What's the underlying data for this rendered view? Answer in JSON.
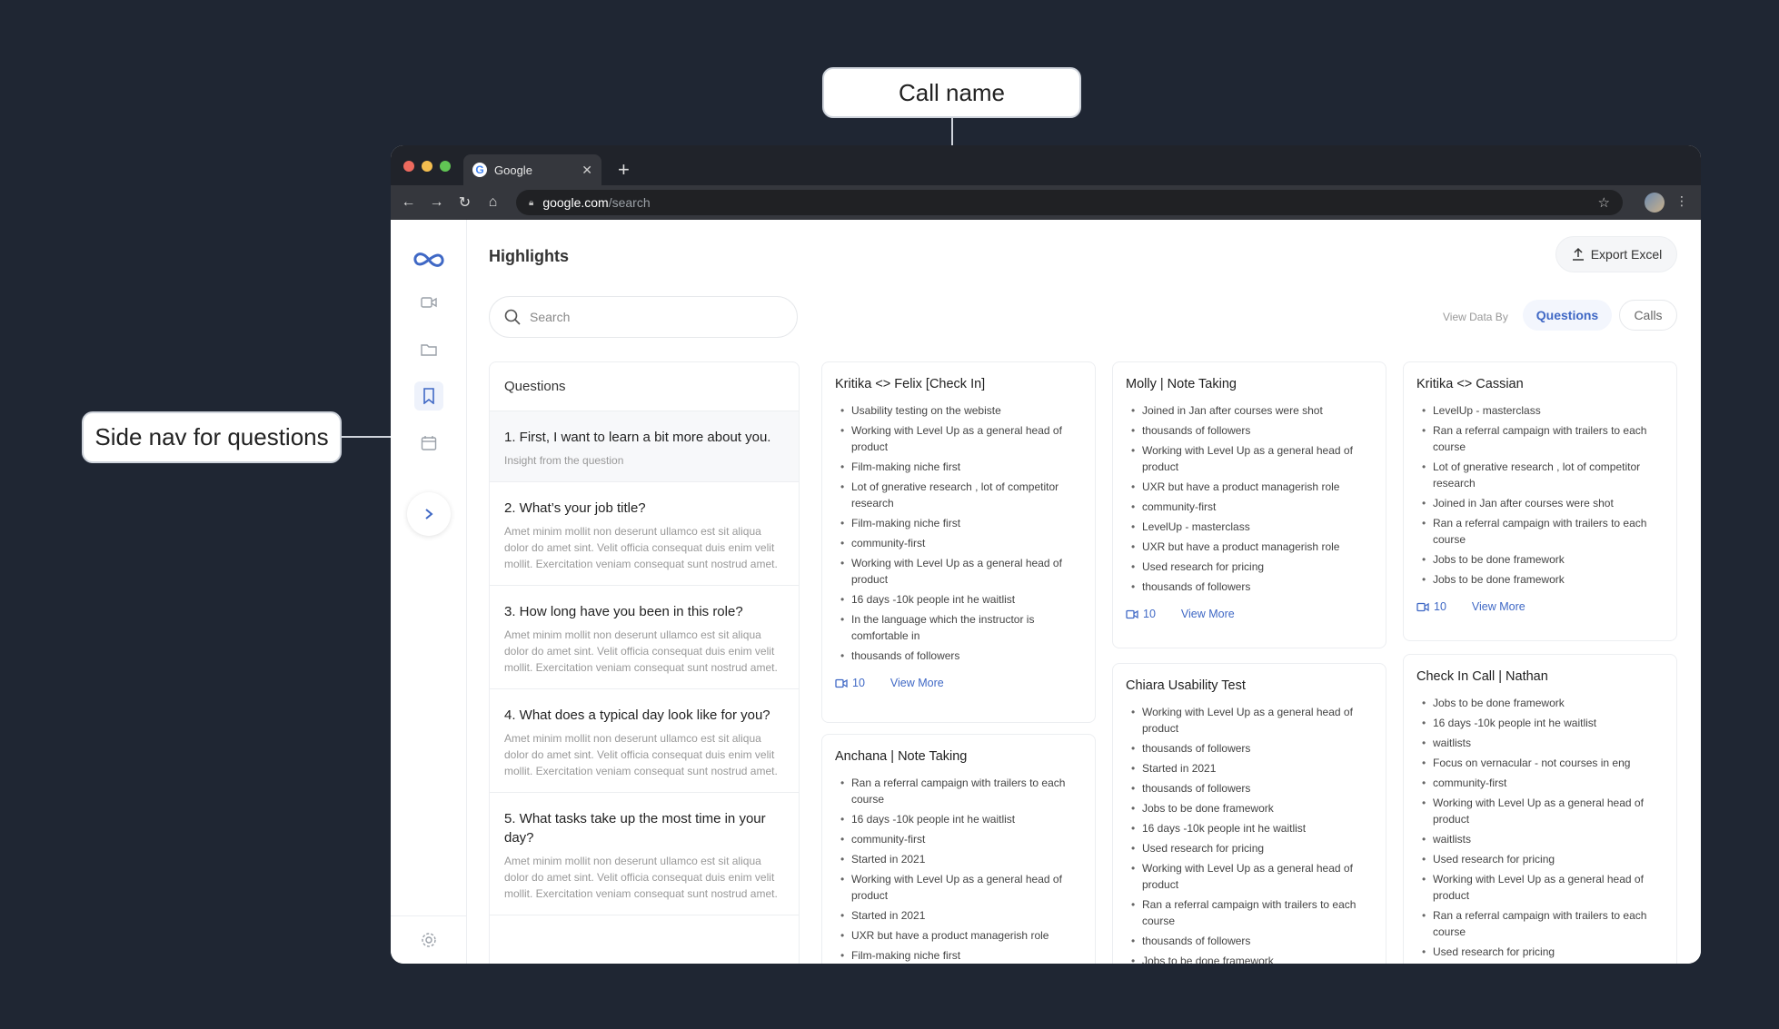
{
  "callouts": {
    "call_name": "Call name",
    "side_nav": "Side nav for questions"
  },
  "browser": {
    "tab_title": "Google",
    "url_domain": "google.com",
    "url_path": "/search",
    "dot_colors": [
      "#ed6a5e",
      "#f4be4f",
      "#61c554"
    ]
  },
  "app": {
    "title": "Highlights",
    "export_label": "Export Excel",
    "search_placeholder": "Search",
    "view_by_label": "View Data By",
    "view_options": [
      "Questions",
      "Calls"
    ],
    "accent": "#3f68c5",
    "nav_icons": [
      "logo-infinity-icon",
      "video-icon",
      "folder-icon",
      "bookmark-icon",
      "calendar-icon",
      "chevron-right-icon",
      "settings-icon"
    ]
  },
  "questions": {
    "header": "Questions",
    "items": [
      {
        "title": "1. First, I want to learn a bit more about you.",
        "sub": "Insight from the question"
      },
      {
        "title": "2. What’s your job title?",
        "sub": "Amet minim mollit non deserunt ullamco est sit aliqua dolor do amet sint. Velit officia consequat duis enim velit mollit. Exercitation veniam consequat sunt nostrud amet."
      },
      {
        "title": "3. How long have you been in this role?",
        "sub": "Amet minim mollit non deserunt ullamco est sit aliqua dolor do amet sint. Velit officia consequat duis enim velit mollit. Exercitation veniam consequat sunt nostrud amet."
      },
      {
        "title": "4. What does a typical day look like for you?",
        "sub": "Amet minim mollit non deserunt ullamco est sit aliqua dolor do amet sint. Velit officia consequat duis enim velit mollit. Exercitation veniam consequat sunt nostrud amet."
      },
      {
        "title": "5. What tasks take up the most time in your day?",
        "sub": "Amet minim mollit non deserunt ullamco est sit aliqua dolor do amet sint. Velit officia consequat duis enim velit mollit. Exercitation veniam consequat sunt nostrud amet."
      }
    ]
  },
  "cards": [
    {
      "title": "Kritika <> Felix [Check In]",
      "count": "10",
      "more": "View More",
      "bullets": [
        "Usability testing on the webiste",
        "Working with Level Up as a general head of product",
        "Film-making niche first",
        "Lot of gnerative research , lot of competitor research",
        "Film-making niche first",
        "community-first",
        "Working with Level Up as a general head of product",
        "16 days -10k people int he waitlist",
        "In the language which the instructor is comfortable in",
        "thousands of followers"
      ]
    },
    {
      "title": "Anchana | Note Taking",
      "count": "",
      "more": "",
      "bullets": [
        "Ran a referral campaign with trailers to each course",
        "16 days -10k people int he waitlist",
        "community-first",
        "Started in 2021",
        "Working with Level Up as a general head of product",
        "Started in 2021",
        "UXR but have a product managerish role",
        "Film-making niche first"
      ]
    },
    {
      "title": "Molly | Note Taking",
      "count": "10",
      "more": "View More",
      "bullets": [
        "Joined in Jan after courses were shot",
        "thousands of followers",
        "Working with Level Up as a general head of product",
        "UXR but have a product managerish role",
        "community-first",
        "LevelUp - masterclass",
        "UXR but have a product managerish role",
        "Used research for pricing",
        "thousands of followers"
      ]
    },
    {
      "title": "Chiara Usability Test",
      "count": "",
      "more": "",
      "bullets": [
        "Working with Level Up as a general head of product",
        "thousands of followers",
        "Started in 2021",
        "thousands of followers",
        "Jobs to be done framework",
        "16 days -10k people int he waitlist",
        "Used research for pricing",
        "Working with Level Up as a general head of product",
        "Ran a referral campaign with trailers to each course",
        "thousands of followers",
        "Jobs to be done framework"
      ]
    },
    {
      "title": "Kritika <> Cassian",
      "count": "10",
      "more": "View More",
      "bullets": [
        "LevelUp - masterclass",
        "Ran a referral campaign with trailers to each course",
        "Lot of gnerative research , lot of competitor research",
        "Joined in Jan after courses were shot",
        "Ran a referral campaign with trailers to each course",
        "Jobs to be done framework",
        "Jobs to be done framework"
      ]
    },
    {
      "title": "Check In Call | Nathan",
      "count": "",
      "more": "",
      "bullets": [
        "Jobs to be done framework",
        "16 days -10k people int he waitlist",
        "waitlists",
        "Focus on vernacular - not courses in eng",
        "community-first",
        "Working with Level Up as a general head of product",
        "waitlists",
        "Used research for pricing",
        "Working with Level Up as a general head of product",
        "Ran a referral campaign with trailers to each course",
        "Used research for pricing"
      ]
    }
  ]
}
